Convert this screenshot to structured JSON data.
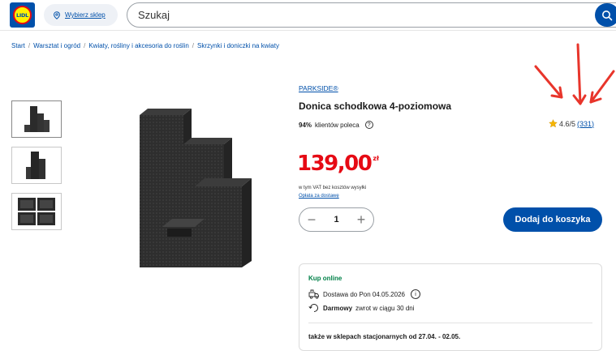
{
  "header": {
    "logo_text": "LIDL",
    "store_label": "Wybierz sklep",
    "search_placeholder": "Szukaj"
  },
  "breadcrumb": [
    "Start",
    "Warsztat i ogród",
    "Kwiaty, rośliny i akcesoria do roślin",
    "Skrzynki i doniczki na kwiaty"
  ],
  "product": {
    "brand": "PARKSIDE®",
    "title": "Donica schodkowa 4-poziomowa",
    "recommend_percent": "94%",
    "recommend_text": "klientów poleca",
    "rating": "4.6/5",
    "rating_count": "(331)",
    "price": "139,00",
    "currency": "zł",
    "vat_note": "w tym VAT bez kosztów wysyłki",
    "delivery_fee_link": "Opłata za dostawę",
    "quantity": "1",
    "add_to_cart": "Dodaj do koszyka"
  },
  "delivery": {
    "heading": "Kup online",
    "delivery_text": "Dostawa do Pon 04.05.2026",
    "return_bold": "Darmowy",
    "return_text": "zwrot w ciągu 30 dni",
    "stores_text": "także w sklepach stacjonarnych od 27.04. - 02.05."
  },
  "colors": {
    "brand_blue": "#0050aa",
    "price_red": "#e60a14",
    "online_green": "#008048",
    "annotation_red": "#e8352b"
  },
  "icons": [
    "lidl-logo",
    "location-pin-icon",
    "search-icon",
    "info-icon",
    "star-icon",
    "delivery-truck-icon",
    "return-icon",
    "minus-icon",
    "plus-icon"
  ]
}
